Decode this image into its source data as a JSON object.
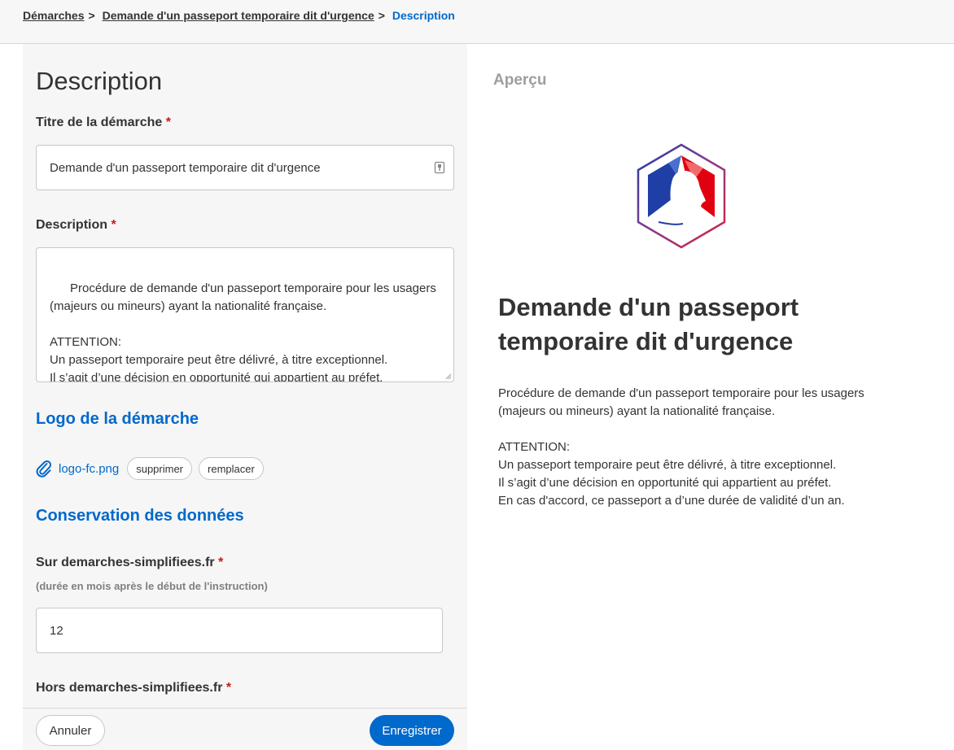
{
  "breadcrumb": {
    "items": [
      "Démarches",
      "Demande d'un passeport temporaire dit d'urgence"
    ],
    "separator": ">",
    "current": "Description"
  },
  "form": {
    "page_title": "Description",
    "title_field": {
      "label": "Titre de la démarche",
      "required_mark": "*",
      "value": "Demande d'un passeport temporaire dit d'urgence"
    },
    "description_field": {
      "label": "Description",
      "required_mark": "*",
      "value": "Procédure de demande d'un passeport temporaire pour les usagers (majeurs ou mineurs) ayant la nationalité française.\n\nATTENTION:\nUn passeport temporaire peut être délivré, à titre exceptionnel.\nIl s’agit d’une décision en opportunité qui appartient au préfet.\nEn cas d'accord, ce passeport a d’une durée de validité d’un an."
    },
    "logo_section": {
      "title": "Logo de la démarche",
      "file_name": "logo-fc.png",
      "delete_label": "supprimer",
      "replace_label": "remplacer"
    },
    "retention_section": {
      "title": "Conservation des données",
      "on_site": {
        "label": "Sur demarches-simplifiees.fr",
        "required_mark": "*",
        "hint": "(durée en mois après le début de l'instruction)",
        "value": "12"
      },
      "off_site": {
        "label": "Hors demarches-simplifiees.fr",
        "required_mark": "*"
      }
    }
  },
  "footer": {
    "cancel_label": "Annuler",
    "save_label": "Enregistrer"
  },
  "preview": {
    "title": "Aperçu",
    "heading": "Demande d'un passeport temporaire dit d'urgence",
    "description": "Procédure de demande d'un passeport temporaire pour les usagers (majeurs ou mineurs) ayant la nationalité française.\n\nATTENTION:\nUn passeport temporaire peut être délivré, à titre exceptionnel.\nIl s’agit d’une décision en opportunité qui appartient au préfet.\nEn cas d'accord, ce passeport a d’une durée de validité d’un an.",
    "logo_icon": "marianne-hexagon-logo"
  },
  "colors": {
    "accent": "#0069cc",
    "required": "#c9191e",
    "panel_bg": "#f6f6f6"
  }
}
